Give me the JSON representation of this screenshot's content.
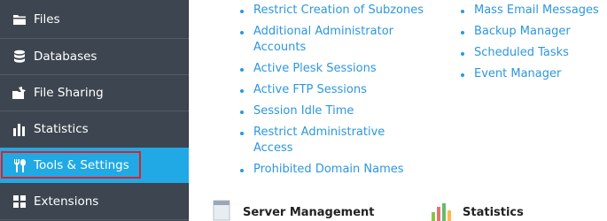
{
  "sidebar": {
    "items": [
      {
        "label": "Files",
        "icon": "folder-icon"
      },
      {
        "label": "Databases",
        "icon": "database-icon"
      },
      {
        "label": "File Sharing",
        "icon": "file-sharing-icon"
      },
      {
        "label": "Statistics",
        "icon": "statistics-icon"
      },
      {
        "label": "Tools & Settings",
        "icon": "tools-icon",
        "active": true,
        "highlighted": true
      },
      {
        "label": "Extensions",
        "icon": "extensions-icon"
      }
    ]
  },
  "links": {
    "col1": [
      "Restrict Creation of Subzones",
      "Additional Administrator Accounts",
      "Active Plesk Sessions",
      "Active FTP Sessions",
      "Session Idle Time",
      "Restrict Administrative Access",
      "Prohibited Domain Names"
    ],
    "col2": [
      "Mass Email Messages",
      "Backup Manager",
      "Scheduled Tasks",
      "Event Manager"
    ]
  },
  "sections": {
    "server_management": "Server Management",
    "statistics": "Statistics"
  },
  "colors": {
    "sidebar_bg": "#3d4650",
    "active_bg": "#20a9e4",
    "highlight_border": "#d9232a",
    "link": "#2c97de"
  }
}
